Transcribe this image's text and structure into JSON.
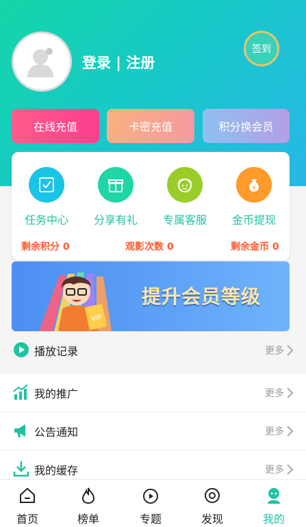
{
  "header": {
    "login_label": "登录 | 注册",
    "signin_label": "签到",
    "actions": [
      {
        "label": "在线充值"
      },
      {
        "label": "卡密充值"
      },
      {
        "label": "积分换会员"
      }
    ]
  },
  "features": {
    "items": [
      {
        "label": "任务中心",
        "icon": "task-icon",
        "color": "#19c4e6"
      },
      {
        "label": "分享有礼",
        "icon": "gift-icon",
        "color": "#21d6a6"
      },
      {
        "label": "专属客服",
        "icon": "service-icon",
        "color": "#9acd2a"
      },
      {
        "label": "金币提现",
        "icon": "coin-bag-icon",
        "color": "#ff9a2b"
      }
    ],
    "stats": {
      "points": "剩余积分 0",
      "views": "观影次数 0",
      "coins": "剩余金币 0"
    }
  },
  "banner": {
    "text": "提升会员等级"
  },
  "list": {
    "play_history": {
      "label": "播放记录",
      "more": "更多"
    },
    "items": [
      {
        "label": "我的推广",
        "more": "更多"
      },
      {
        "label": "公告通知",
        "more": "更多"
      },
      {
        "label": "我的缓存",
        "more": "更多"
      }
    ]
  },
  "tabs": [
    {
      "label": "首页",
      "icon": "home-icon"
    },
    {
      "label": "榜单",
      "icon": "flame-icon"
    },
    {
      "label": "专题",
      "icon": "topic-icon"
    },
    {
      "label": "发现",
      "icon": "discover-icon"
    },
    {
      "label": "我的",
      "icon": "profile-icon",
      "active": true
    }
  ],
  "colors": {
    "accent": "#1ec3a2",
    "stat_text": "#ff5a2e"
  }
}
